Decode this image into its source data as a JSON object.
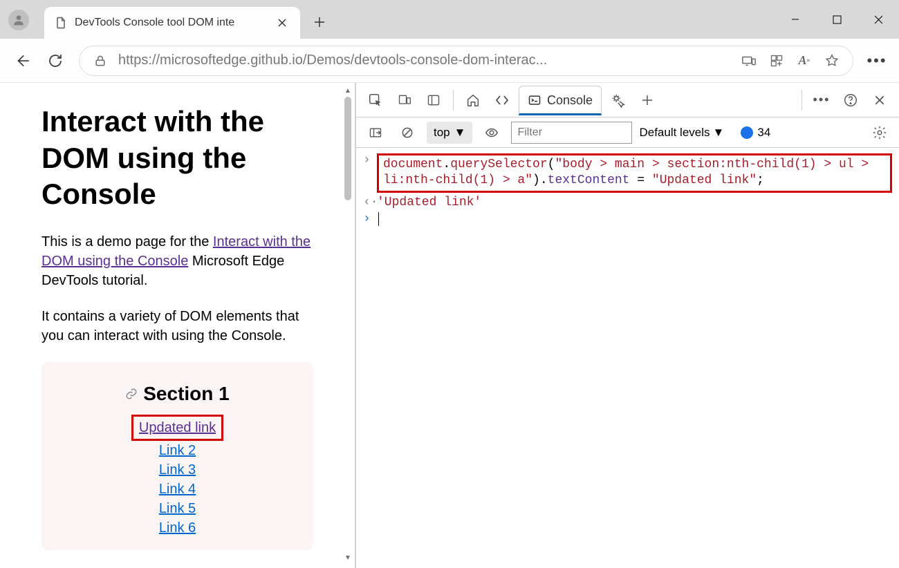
{
  "browser": {
    "tab_title": "DevTools Console tool DOM inte",
    "url": "https://microsoftedge.github.io/Demos/devtools-console-dom-interac..."
  },
  "page": {
    "h1": "Interact with the DOM using the Console",
    "intro_before": "This is a demo page for the ",
    "intro_link": "Interact with the DOM using the Console",
    "intro_after": " Microsoft Edge DevTools tutorial.",
    "p2": "It contains a variety of DOM elements that you can interact with using the Console.",
    "section_title": "Section 1",
    "links": [
      "Updated link",
      "Link 2",
      "Link 3",
      "Link 4",
      "Link 5",
      "Link 6"
    ]
  },
  "devtools": {
    "active_tab": "Console",
    "context": "top",
    "filter_placeholder": "Filter",
    "levels": "Default levels",
    "msg_count": "34",
    "cmd": "document.querySelector(\"body > main > section:nth-child(1) > ul > li:nth-child(1) > a\").textContent = \"Updated link\";",
    "result": "'Updated link'"
  }
}
